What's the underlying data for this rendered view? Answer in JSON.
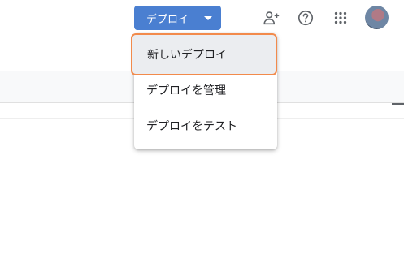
{
  "header": {
    "deploy_button_label": "デプロイ",
    "icons": {
      "add_person": "person-add-icon",
      "help": "help-icon",
      "apps": "apps-grid-icon",
      "avatar": "user-avatar"
    }
  },
  "deploy_menu": {
    "items": [
      {
        "label": "新しいデプロイ",
        "active": true
      },
      {
        "label": "デプロイを管理"
      },
      {
        "label": "デプロイをテスト"
      }
    ]
  },
  "colors": {
    "primary_button": "#4a7fd1",
    "focus_ring": "#f28a4b",
    "hover_bg": "#ebedf0"
  }
}
